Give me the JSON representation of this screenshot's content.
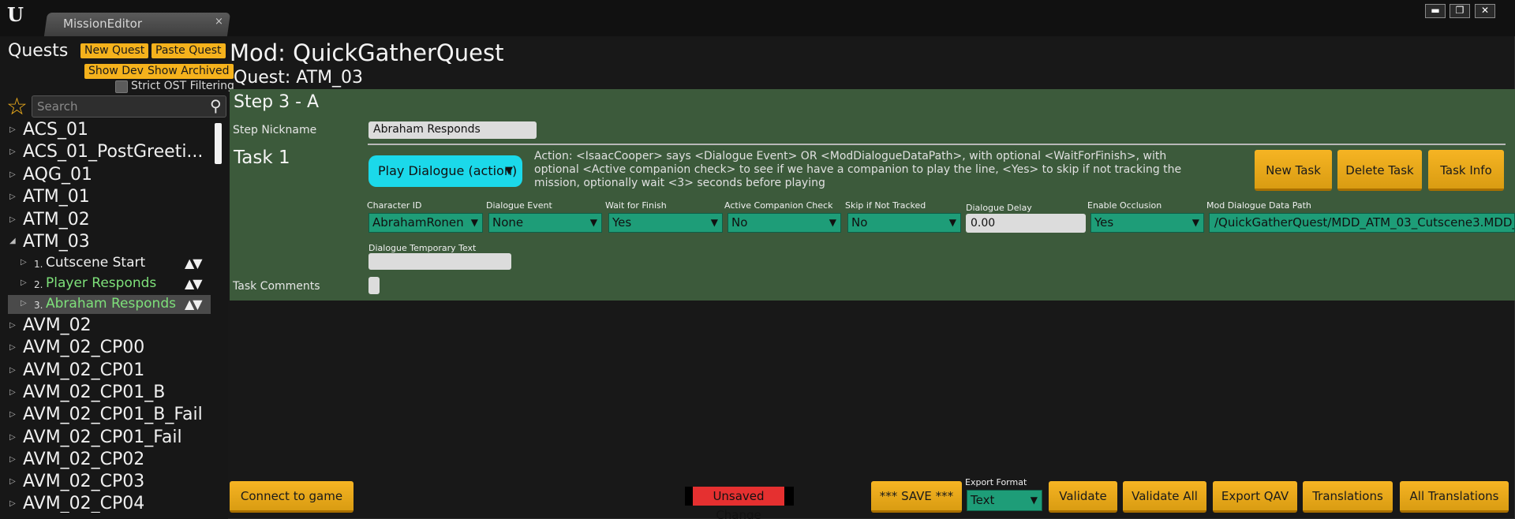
{
  "window": {
    "tab_label": "MissionEditor",
    "tab_close": "×",
    "logo": "U",
    "controls": [
      "▬",
      "❐",
      "✕"
    ]
  },
  "sidebar": {
    "title": "Quests",
    "new_quest": "New Quest",
    "paste_quest": "Paste Quest",
    "show_dev": "Show Dev",
    "show_archived": "Show Archived",
    "strict_filter": "Strict OST Filtering",
    "search_placeholder": "Search",
    "quests": [
      "ACS_01",
      "ACS_01_PostGreeti...",
      "AQG_01",
      "ATM_01",
      "ATM_02",
      "ATM_03"
    ],
    "steps": [
      {
        "num": "1.",
        "label": "Cutscene Start",
        "color": "#f0f0f0"
      },
      {
        "num": "2.",
        "label": "Player Responds",
        "color": "#7ee07a"
      },
      {
        "num": "3.",
        "label": "Abraham Responds",
        "color": "#7ee07a"
      }
    ],
    "quests_after": [
      "AVM_02",
      "AVM_02_CP00",
      "AVM_02_CP01",
      "AVM_02_CP01_B",
      "AVM_02_CP01_B_Fail",
      "AVM_02_CP01_Fail",
      "AVM_02_CP02",
      "AVM_02_CP03",
      "AVM_02_CP04"
    ]
  },
  "header": {
    "mod": "Mod: QuickGatherQuest",
    "quest": "Quest: ATM_03"
  },
  "step": {
    "title": "Step 3 - A",
    "nickname_label": "Step Nickname",
    "nickname_value": "Abraham Responds"
  },
  "task": {
    "title": "Task 1",
    "action": "Play Dialogue (action)",
    "description": "Action: <IsaacCooper> says <Dialogue Event> OR <ModDialogueDataPath>, with optional <WaitForFinish>, with optional <Active companion check> to see if we have a companion to play the line, <Yes> to skip if not tracking the mission, optionally wait <3> seconds before playing",
    "new_task": "New Task",
    "delete_task": "Delete Task",
    "task_info": "Task Info",
    "fields": {
      "character_id_label": "Character ID",
      "character_id": "AbrahamRonen",
      "dialogue_event_label": "Dialogue Event",
      "dialogue_event": "None",
      "wait_label": "Wait for Finish",
      "wait": "Yes",
      "companion_label": "Active Companion Check",
      "companion": "No",
      "skip_label": "Skip if Not Tracked",
      "skip": "No",
      "delay_label": "Dialogue Delay",
      "delay": "0.00",
      "occlusion_label": "Enable Occlusion",
      "occlusion": "Yes",
      "path_label": "Mod Dialogue Data Path",
      "path": "/QuickGatherQuest/MDD_ATM_03_Cutscene3.MDD_",
      "temp_text_label": "Dialogue Temporary Text",
      "temp_text": ""
    },
    "comments_label": "Task Comments"
  },
  "footer": {
    "connect": "Connect to game",
    "unsaved": "Unsaved Change",
    "save": "*** SAVE ***",
    "export_label": "Export Format",
    "export_value": "Text",
    "validate": "Validate",
    "validate_all": "Validate All",
    "export_qav": "Export QAV",
    "translations": "Translations",
    "all_translations": "All Translations"
  },
  "colors": {
    "accent_yellow": "#f5b21c",
    "panel_green": "#3c5a3b",
    "dropdown_green": "#1e9d78",
    "action_cyan": "#1bd9ea",
    "unsaved_red": "#e53030"
  }
}
